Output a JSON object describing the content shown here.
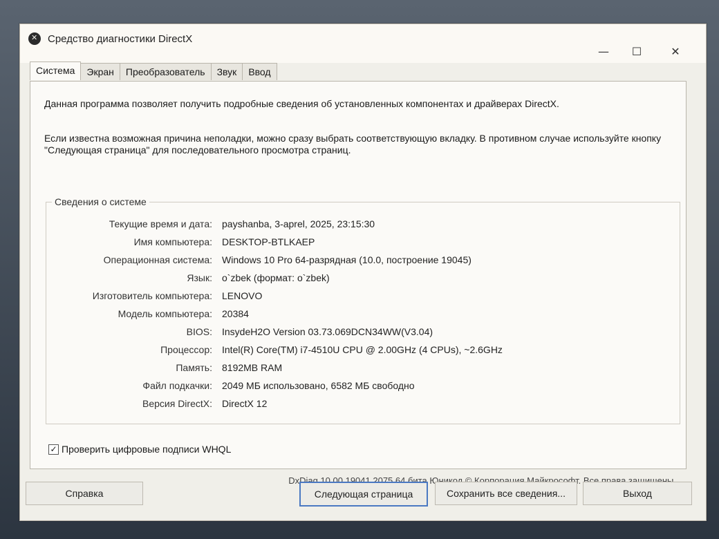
{
  "window": {
    "title": "Средство диагностики DirectX",
    "controls": {
      "minimize": "—",
      "maximize": "☐",
      "close": "✕"
    }
  },
  "tabs": [
    "Система",
    "Экран",
    "Преобразователь",
    "Звук",
    "Ввод"
  ],
  "intro": {
    "line1": "Данная программа позволяет получить подробные сведения об установленных компонентах и драйверах DirectX.",
    "line2": "Если известна возможная причина неполадки, можно сразу выбрать соответствующую вкладку. В противном случае используйте кнопку \"Следующая страница\" для последовательного просмотра страниц."
  },
  "system_info": {
    "group_title": "Сведения о системе",
    "rows": [
      {
        "label": "Текущие время и дата:",
        "value": "payshanba, 3-aprel, 2025, 23:15:30"
      },
      {
        "label": "Имя компьютера:",
        "value": "DESKTOP-BTLKAEP"
      },
      {
        "label": "Операционная система:",
        "value": "Windows 10 Pro 64-разрядная (10.0, построение 19045)"
      },
      {
        "label": "Язык:",
        "value": "o`zbek (формат: o`zbek)"
      },
      {
        "label": "Изготовитель компьютера:",
        "value": "LENOVO"
      },
      {
        "label": "Модель компьютера:",
        "value": "20384"
      },
      {
        "label": "BIOS:",
        "value": "InsydeH2O Version 03.73.069DCN34WW(V3.04)"
      },
      {
        "label": "Процессор:",
        "value": "Intel(R) Core(TM) i7-4510U CPU @ 2.00GHz (4 CPUs), ~2.6GHz"
      },
      {
        "label": "Память:",
        "value": "8192MB RAM"
      },
      {
        "label": "Файл подкачки:",
        "value": "2049 МБ использовано, 6582 МБ свободно"
      },
      {
        "label": "Версия DirectX:",
        "value": "DirectX 12"
      }
    ]
  },
  "whql": {
    "label": "Проверить цифровые подписи WHQL",
    "checked_glyph": "✓"
  },
  "footer_note": "DxDiag 10.00.19041.2075 64 бита Юникод  © Корпорация Майкрософт. Все права защищены.",
  "buttons": {
    "help": "Справка",
    "next": "Следующая страница",
    "save": "Сохранить все сведения...",
    "exit": "Выход"
  }
}
